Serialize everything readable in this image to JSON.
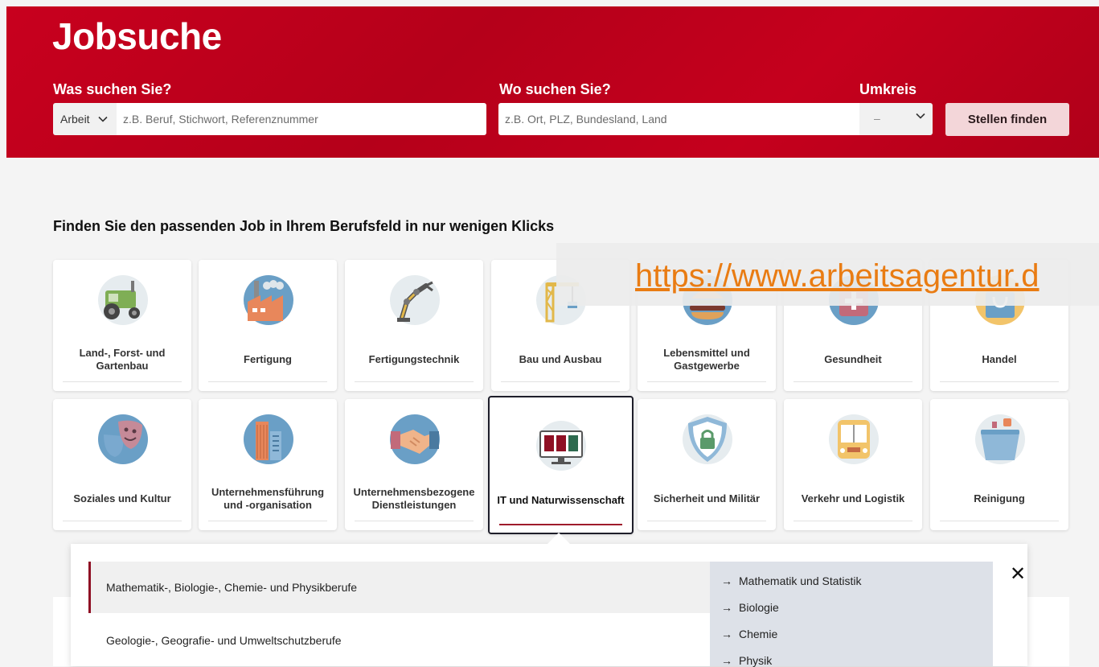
{
  "header": {
    "title": "Jobsuche",
    "what_label": "Was suchen Sie?",
    "where_label": "Wo suchen Sie?",
    "radius_label": "Umkreis",
    "type_select": "Arbeit",
    "what_placeholder": "z.B. Beruf, Stichwort, Referenznummer",
    "where_placeholder": "z.B. Ort, PLZ, Bundesland, Land",
    "radius_value": "–",
    "search_button": "Stellen finden"
  },
  "section": {
    "heading": "Finden Sie den passenden Job in Ihrem Berufsfeld in nur wenigen Klicks"
  },
  "overlay_url": "https://www.arbeitsagentur.d",
  "tiles": [
    {
      "label": "Land-, Forst- und Gartenbau",
      "icon": "tractor-icon"
    },
    {
      "label": "Fertigung",
      "icon": "factory-icon"
    },
    {
      "label": "Fertigungstechnik",
      "icon": "robot-arm-icon"
    },
    {
      "label": "Bau und Ausbau",
      "icon": "crane-icon"
    },
    {
      "label": "Lebensmittel und Gastgewerbe",
      "icon": "burger-icon"
    },
    {
      "label": "Gesundheit",
      "icon": "medical-icon"
    },
    {
      "label": "Handel",
      "icon": "shopping-bag-icon"
    },
    {
      "label": "Soziales und Kultur",
      "icon": "theater-masks-icon"
    },
    {
      "label": "Unternehmensführung und -organisation",
      "icon": "office-building-icon"
    },
    {
      "label": "Unternehmensbezogene Dienstleistungen",
      "icon": "handshake-icon"
    },
    {
      "label": "IT und Naturwissenschaft",
      "icon": "monitor-icon"
    },
    {
      "label": "Sicherheit und Militär",
      "icon": "shield-lock-icon"
    },
    {
      "label": "Verkehr und Logistik",
      "icon": "bus-icon"
    },
    {
      "label": "Reinigung",
      "icon": "cleaning-bucket-icon"
    }
  ],
  "panel": {
    "categories": [
      "Mathematik-, Biologie-, Chemie- und Physikberufe",
      "Geologie-, Geografie- und Umweltschutzberufe"
    ],
    "subcategories": [
      "Mathematik und Statistik",
      "Biologie",
      "Chemie",
      "Physik"
    ],
    "close": "✕"
  },
  "colors": {
    "brand_red": "#c8001e",
    "active_underline": "#9e1b2c",
    "link_orange": "#e97c13"
  }
}
